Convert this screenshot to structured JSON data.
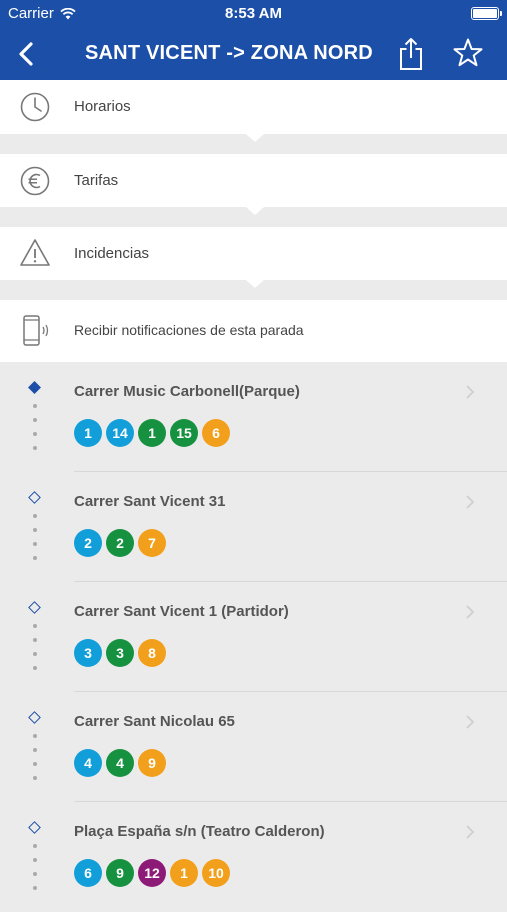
{
  "status_bar": {
    "carrier": "Carrier",
    "time": "8:53 AM"
  },
  "header": {
    "title": "SANT VICENT -> ZONA NORD"
  },
  "menu": [
    {
      "label": "Horarios",
      "icon": "clock-icon"
    },
    {
      "label": "Tarifas",
      "icon": "euro-icon"
    },
    {
      "label": "Incidencias",
      "icon": "warning-icon"
    },
    {
      "label": "Recibir notificaciones de esta parada",
      "icon": "phone-notification-icon"
    }
  ],
  "colors": {
    "brand": "#1c4fa8",
    "blue_line": "#129fd9",
    "green_line": "#16913f",
    "orange_line": "#f2a01b",
    "purple_line": "#8e1a78"
  },
  "stops": [
    {
      "name": "Carrer Music Carbonell(Parque)",
      "current": true,
      "lines": [
        {
          "n": "1",
          "c": "#129fd9"
        },
        {
          "n": "14",
          "c": "#129fd9"
        },
        {
          "n": "1",
          "c": "#16913f"
        },
        {
          "n": "15",
          "c": "#16913f"
        },
        {
          "n": "6",
          "c": "#f2a01b"
        }
      ]
    },
    {
      "name": "Carrer Sant Vicent 31",
      "current": false,
      "lines": [
        {
          "n": "2",
          "c": "#129fd9"
        },
        {
          "n": "2",
          "c": "#16913f"
        },
        {
          "n": "7",
          "c": "#f2a01b"
        }
      ]
    },
    {
      "name": "Carrer Sant Vicent 1 (Partidor)",
      "current": false,
      "lines": [
        {
          "n": "3",
          "c": "#129fd9"
        },
        {
          "n": "3",
          "c": "#16913f"
        },
        {
          "n": "8",
          "c": "#f2a01b"
        }
      ]
    },
    {
      "name": "Carrer Sant Nicolau 65",
      "current": false,
      "lines": [
        {
          "n": "4",
          "c": "#129fd9"
        },
        {
          "n": "4",
          "c": "#16913f"
        },
        {
          "n": "9",
          "c": "#f2a01b"
        }
      ]
    },
    {
      "name": "Plaça España s/n (Teatro Calderon)",
      "current": false,
      "lines": [
        {
          "n": "6",
          "c": "#129fd9"
        },
        {
          "n": "9",
          "c": "#16913f"
        },
        {
          "n": "12",
          "c": "#8e1a78"
        },
        {
          "n": "1",
          "c": "#f2a01b"
        },
        {
          "n": "10",
          "c": "#f2a01b"
        }
      ]
    }
  ]
}
